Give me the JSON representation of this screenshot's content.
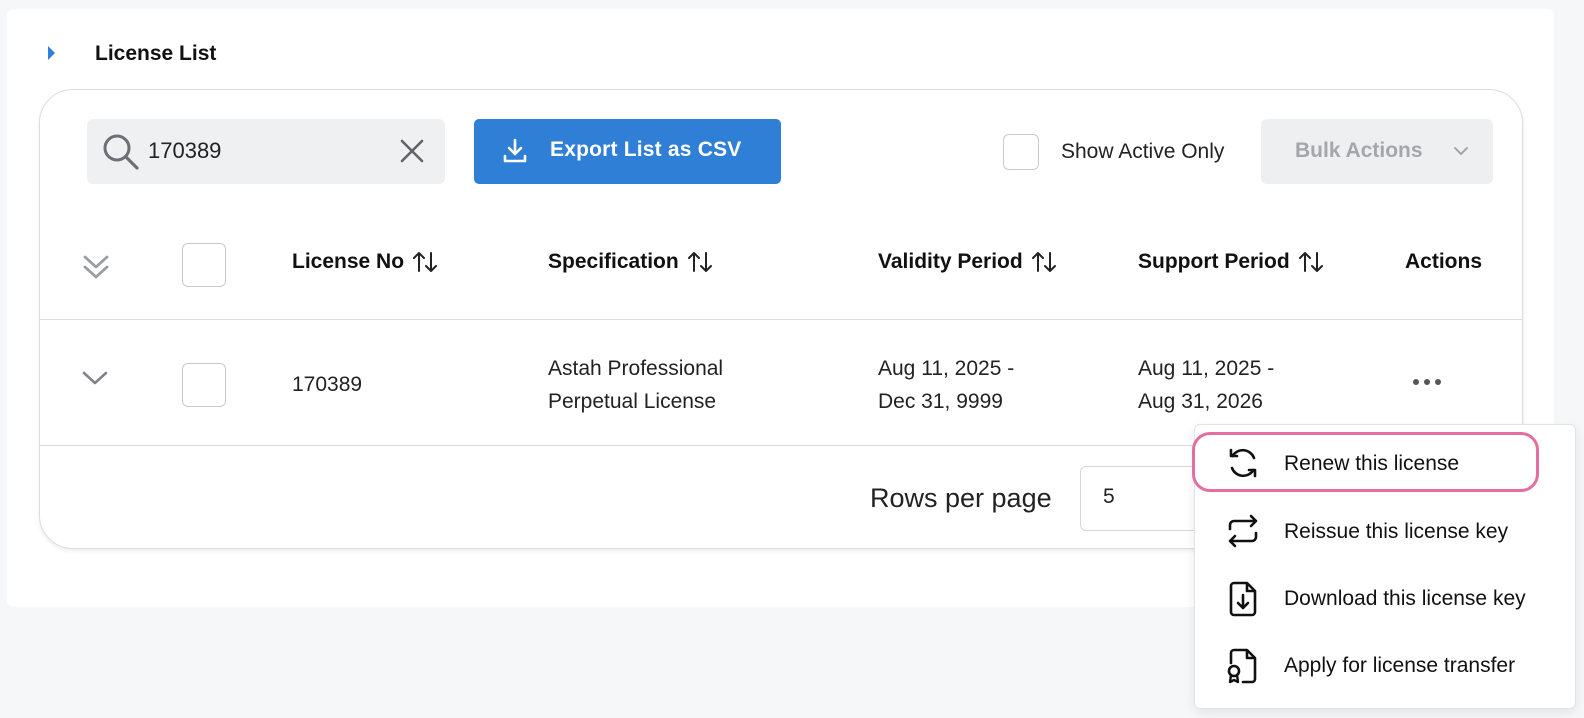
{
  "section": {
    "title": "License List"
  },
  "toolbar": {
    "search_value": "170389",
    "export_label": "Export List as CSV",
    "active_only_label": "Show Active Only",
    "bulk_actions_label": "Bulk Actions"
  },
  "table": {
    "columns": [
      "License No",
      "Specification",
      "Validity Period",
      "Support Period",
      "Actions"
    ],
    "rows": [
      {
        "license_no": "170389",
        "spec_line1": "Astah Professional",
        "spec_line2": "Perpetual License",
        "validity_line1": "Aug 11, 2025 -",
        "validity_line2": "Dec 31, 9999",
        "support_line1": "Aug 11, 2025 -",
        "support_line2": "Aug 31, 2026"
      }
    ]
  },
  "pagination": {
    "rows_per_page_label": "Rows per page",
    "rows_per_page_value": "5"
  },
  "action_menu": {
    "items": [
      {
        "label": "Renew this license",
        "icon": "refresh-icon"
      },
      {
        "label": "Reissue this license key",
        "icon": "repeat-icon"
      },
      {
        "label": "Download this license key",
        "icon": "file-download-icon"
      },
      {
        "label": "Apply for license transfer",
        "icon": "file-certificate-icon"
      }
    ]
  },
  "colors": {
    "primary": "#2f7fd6",
    "highlight": "#e46ea0"
  }
}
